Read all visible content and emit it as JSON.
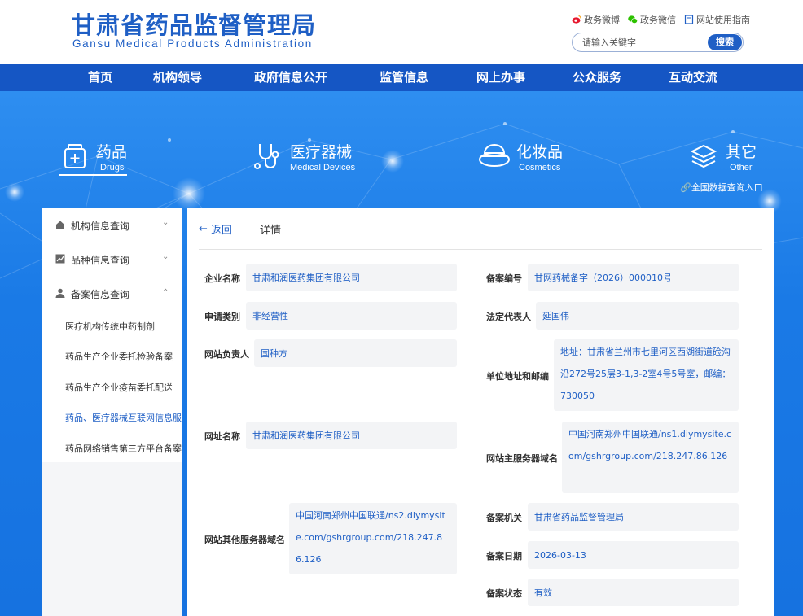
{
  "header": {
    "title_cn": "甘肃省药品监督管理局",
    "title_en": "Gansu Medical Products Administration",
    "links": [
      {
        "label": "政务微博",
        "icon": "weibo-icon"
      },
      {
        "label": "政务微信",
        "icon": "wechat-icon"
      },
      {
        "label": "网站使用指南",
        "icon": "guide-icon"
      }
    ],
    "search_placeholder": "请输入关键字",
    "search_button": "搜索"
  },
  "nav": [
    "首页",
    "机构领导",
    "政府信息公开",
    "监管信息",
    "网上办事",
    "公众服务",
    "互动交流"
  ],
  "categories": [
    {
      "cn": "药品",
      "en": "Drugs",
      "icon": "drug-box-icon"
    },
    {
      "cn": "医疗器械",
      "en": "Medical Devices",
      "icon": "stethoscope-icon"
    },
    {
      "cn": "化妆品",
      "en": "Cosmetics",
      "icon": "cosmetics-jar-icon"
    },
    {
      "cn": "其它",
      "en": "Other",
      "icon": "layers-icon"
    }
  ],
  "national_link": "全国数据查询入口",
  "sidebar": {
    "sections": [
      {
        "label": "机构信息查询",
        "icon": "home-icon"
      },
      {
        "label": "品种信息查询",
        "icon": "chart-icon"
      },
      {
        "label": "备案信息查询",
        "icon": "user-icon"
      }
    ],
    "sub_items": [
      "医疗机构传统中药制剂",
      "药品生产企业委托检验备案",
      "药品生产企业疫苗委托配送",
      "药品、医疗器械互联网信息服务备案",
      "药品网络销售第三方平台备案"
    ]
  },
  "detail": {
    "back_label": "返回",
    "title": "详情",
    "fields": {
      "company_name": {
        "label": "企业名称",
        "value": "甘肃和润医药集团有限公司"
      },
      "record_no": {
        "label": "备案编号",
        "value": "甘网药械备字（2026）000010号"
      },
      "apply_type": {
        "label": "申请类别",
        "value": "非经营性"
      },
      "legal_rep": {
        "label": "法定代表人",
        "value": "延国伟"
      },
      "site_manager": {
        "label": "网站负责人",
        "value": "国种方"
      },
      "address": {
        "label": "单位地址和邮编",
        "value": "地址：甘肃省兰州市七里河区西湖街道硷沟沿272号25层3-1,3-2室4号5号室，邮编：730050"
      },
      "site_name": {
        "label": "网址名称",
        "value": "甘肃和润医药集团有限公司"
      },
      "main_domain": {
        "label": "网站主服务器域名",
        "value": "中国河南郑州中国联通/ns1.diymysite.com/gshrgroup.com/218.247.86.126"
      },
      "other_domain": {
        "label": "网站其他服务器域名",
        "value": "中国河南郑州中国联通/ns2.diymysite.com/gshrgroup.com/218.247.86.126"
      },
      "authority": {
        "label": "备案机关",
        "value": "甘肃省药品监督管理局"
      },
      "record_date": {
        "label": "备案日期",
        "value": "2026-03-13"
      },
      "record_status": {
        "label": "备案状态",
        "value": "有效"
      }
    }
  }
}
